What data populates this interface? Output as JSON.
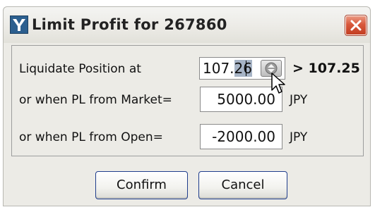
{
  "dialog": {
    "title": "Limit Profit for 267860",
    "app_icon": "app-logo-icon",
    "close_icon": "close-icon"
  },
  "form": {
    "liquidate": {
      "label": "Liquidate Position at",
      "value_plain": "107.",
      "value_selected": "26",
      "rate_text": "> 107.25"
    },
    "pl_market": {
      "label": "or when PL from Market=",
      "value": "5000.00",
      "unit": "JPY"
    },
    "pl_open": {
      "label": "or when PL from Open=",
      "value": "-2000.00",
      "unit": "JPY"
    }
  },
  "buttons": {
    "confirm_label": "Confirm",
    "cancel_label": "Cancel"
  },
  "colors": {
    "close_button": "#d8583b",
    "focus_border": "#1f3d8c",
    "selection": "#a7b4c6"
  }
}
